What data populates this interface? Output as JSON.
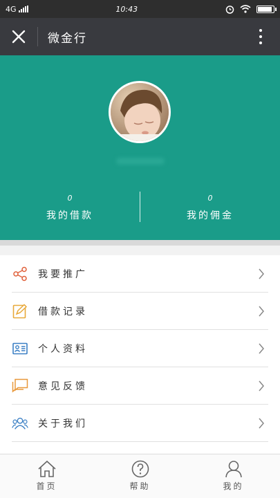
{
  "status_bar": {
    "network": "4G",
    "time": "10:43",
    "battery_level": 0.95
  },
  "nav": {
    "title": "微金行"
  },
  "profile": {
    "stats": [
      {
        "value": "0",
        "label": "我的借款"
      },
      {
        "value": "0",
        "label": "我的佣金"
      }
    ]
  },
  "menu": {
    "items": [
      {
        "label": "我要推广",
        "icon": "share-icon",
        "color": "#e0603a"
      },
      {
        "label": "借款记录",
        "icon": "edit-note-icon",
        "color": "#e8a93a"
      },
      {
        "label": "个人资料",
        "icon": "id-card-icon",
        "color": "#3a7fc4"
      },
      {
        "label": "意见反馈",
        "icon": "chat-bubble-icon",
        "color": "#e8983a"
      },
      {
        "label": "关于我们",
        "icon": "users-icon",
        "color": "#3a7fc4"
      }
    ]
  },
  "tabs": [
    {
      "label": "首页",
      "icon": "home-icon"
    },
    {
      "label": "帮助",
      "icon": "help-icon"
    },
    {
      "label": "我的",
      "icon": "user-icon"
    }
  ],
  "colors": {
    "primary": "#1a9c89",
    "nav_bg": "#393a3f"
  }
}
